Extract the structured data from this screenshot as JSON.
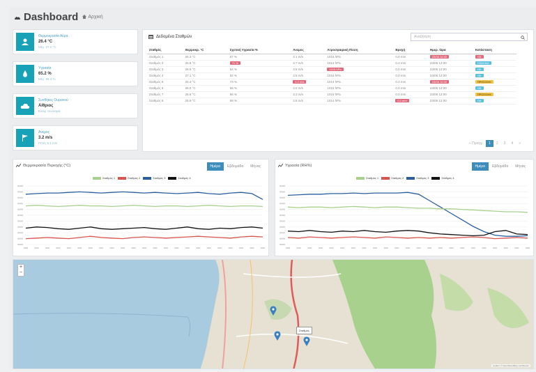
{
  "header": {
    "title": "Dashboard",
    "crumb": "Αρχική"
  },
  "stats": [
    {
      "label": "Θερμοκρασία Αέρα",
      "value": "26.4 °C",
      "sub": "Μέγ. 27.2 °C"
    },
    {
      "label": "Υγρασία",
      "value": "65.2 %",
      "sub": "Μέγ. 66.4 %"
    },
    {
      "label": "Συνθήκες Ουρανού",
      "value": "Αίθριος",
      "sub": "Ελαφ. συννεφιά"
    },
    {
      "label": "Ανεμος",
      "value": "3.2 m/s",
      "sub": "Ριπές 5.1 m/s"
    }
  ],
  "table": {
    "title": "Δεδομένα Σταθμών",
    "search_placeholder": "Αναζήτηση",
    "columns": [
      "Σταθμός",
      "Θερμοκρ. °C",
      "Σχετική Υγρασία %",
      "Ανεμος",
      "Ατμοσφαιρική Πίεση",
      "Βροχή",
      "Ημερ. Ώρα",
      "Κατάσταση"
    ],
    "rows": [
      [
        "Σταθμός 1",
        "26.3 °C",
        "67 %",
        "3.1 m/s",
        "1015 hPa",
        "0.0 mm",
        "23/06 12:00",
        "OK"
      ],
      [
        "Σταθμός 2",
        "25.8 °C",
        "71 %",
        "2.7 m/s",
        "1014 hPa",
        "0.2 mm",
        "23/06 12:00",
        "ΣΦΑΛΜΑ"
      ],
      [
        "Σταθμός 3",
        "26.9 °C",
        "64 %",
        "3.5 m/s",
        "1015 hPa",
        "0.0 mm",
        "23/06 12:00",
        "OK"
      ],
      [
        "Σταθμός 4",
        "27.1 °C",
        "62 %",
        "3.9 m/s",
        "1016 hPa",
        "0.0 mm",
        "23/06 12:00",
        "OK"
      ],
      [
        "Σταθμός 5",
        "25.4 °C",
        "73 %",
        "2.2 m/s",
        "1014 hPa",
        "0.4 mm",
        "23/06 12:00",
        "ΠΡΟΣΟΧΗ"
      ],
      [
        "Σταθμός 6",
        "26.0 °C",
        "68 %",
        "3.0 m/s",
        "1015 hPa",
        "0.0 mm",
        "23/06 12:00",
        "OK"
      ],
      [
        "Σταθμός 7",
        "26.6 °C",
        "66 %",
        "3.3 m/s",
        "1015 hPa",
        "0.0 mm",
        "23/06 12:00",
        "ΠΡΟΣΟΧΗ"
      ],
      [
        "Σταθμός 8",
        "25.9 °C",
        "69 %",
        "2.8 m/s",
        "1014 hPa",
        "0.1 mm",
        "23/06 12:00",
        "OK"
      ]
    ],
    "badges": [
      [
        null,
        null,
        null,
        null,
        null,
        null,
        "red",
        "red"
      ],
      [
        null,
        null,
        "red",
        null,
        null,
        null,
        null,
        "blue"
      ],
      [
        null,
        null,
        null,
        null,
        "red",
        null,
        null,
        "blue"
      ],
      [
        null,
        null,
        null,
        null,
        null,
        null,
        null,
        "blue"
      ],
      [
        null,
        null,
        null,
        "red",
        null,
        null,
        "red",
        "yellow"
      ],
      [
        null,
        null,
        null,
        null,
        null,
        null,
        null,
        "blue"
      ],
      [
        null,
        null,
        null,
        null,
        null,
        null,
        null,
        "yellow"
      ],
      [
        null,
        null,
        null,
        null,
        null,
        "red",
        null,
        "blue"
      ]
    ],
    "pager": {
      "prev": "« Προηγ.",
      "pages": [
        "1",
        "2",
        "3",
        "4",
        "»"
      ]
    }
  },
  "charts": [
    {
      "title": "Θερμοκρασία Περιοχής (°C)",
      "buttons": [
        "Ημέρα",
        "Εβδομάδα",
        "Μήνας"
      ],
      "legend": [
        {
          "name": "Σταθμός 1",
          "color": "#a8d08d"
        },
        {
          "name": "Σταθμός 2",
          "color": "#d9534f"
        },
        {
          "name": "Σταθμός 3",
          "color": "#2a5f9e"
        },
        {
          "name": "Σταθμός 4",
          "color": "#111111"
        }
      ]
    },
    {
      "title": "Υγρασία (RH%)",
      "buttons": [
        "Ημέρα",
        "Εβδομάδα",
        "Μήνας"
      ],
      "legend": [
        {
          "name": "Σταθμός 1",
          "color": "#a8d08d"
        },
        {
          "name": "Σταθμός 2",
          "color": "#d9534f"
        },
        {
          "name": "Σταθμός 3",
          "color": "#2a5f9e"
        },
        {
          "name": "Σταθμός 4",
          "color": "#111111"
        }
      ]
    }
  ],
  "chart_data": [
    {
      "type": "line",
      "title": "Θερμοκρασία Περιοχής (°C)",
      "ylim": [
        0,
        100
      ],
      "series": [
        {
          "name": "Σταθμός 3",
          "color": "#2a5f9e",
          "values": [
            86,
            87,
            88,
            88,
            89,
            90,
            89,
            88,
            89,
            90,
            89,
            88,
            89,
            88,
            87,
            88,
            89,
            87,
            86,
            88,
            89,
            87,
            77
          ]
        },
        {
          "name": "Σταθμός 1",
          "color": "#a8d08d",
          "values": [
            66,
            67,
            66,
            65,
            66,
            67,
            66,
            66,
            65,
            66,
            67,
            66,
            65,
            66,
            66,
            65,
            66,
            67,
            66,
            65,
            66,
            66,
            65
          ]
        },
        {
          "name": "Σταθμός 4",
          "color": "#111111",
          "values": [
            28,
            30,
            29,
            27,
            26,
            28,
            30,
            27,
            26,
            27,
            28,
            29,
            27,
            26,
            28,
            30,
            27,
            26,
            28,
            27,
            29,
            30,
            28
          ]
        },
        {
          "name": "Σταθμός 2",
          "color": "#d9534f",
          "values": [
            10,
            11,
            12,
            11,
            10,
            12,
            14,
            12,
            11,
            10,
            12,
            13,
            12,
            11,
            12,
            13,
            14,
            13,
            12,
            11,
            13,
            14,
            13
          ]
        }
      ]
    },
    {
      "type": "line",
      "title": "Υγρασία (RH%)",
      "ylim": [
        0,
        100
      ],
      "series": [
        {
          "name": "Σταθμός 3",
          "color": "#2a5f9e",
          "values": [
            84,
            85,
            86,
            86,
            87,
            87,
            88,
            87,
            88,
            88,
            88,
            89,
            86,
            75,
            64,
            53,
            42,
            31,
            22,
            16,
            14,
            14,
            15
          ]
        },
        {
          "name": "Σταθμός 1",
          "color": "#a8d08d",
          "values": [
            64,
            63,
            64,
            64,
            63,
            64,
            65,
            64,
            63,
            64,
            64,
            63,
            62,
            62,
            61,
            61,
            60,
            59,
            58,
            57,
            56,
            56,
            55
          ]
        },
        {
          "name": "Σταθμός 4",
          "color": "#111111",
          "values": [
            23,
            22,
            24,
            22,
            21,
            23,
            22,
            24,
            22,
            21,
            23,
            24,
            23,
            20,
            18,
            17,
            16,
            15,
            16,
            22,
            24,
            18,
            17
          ]
        },
        {
          "name": "Σταθμός 2",
          "color": "#d9534f",
          "values": [
            12,
            11,
            13,
            12,
            11,
            12,
            13,
            12,
            11,
            13,
            12,
            11,
            12,
            11,
            12,
            11,
            12,
            13,
            12,
            10,
            11,
            12,
            11
          ]
        }
      ]
    }
  ],
  "map": {
    "zoom_in": "+",
    "zoom_out": "−",
    "marker_label": "Σταθμός",
    "attribution": "Leaflet | © OpenStreetMap contributors"
  },
  "colors": {
    "accent": "#17a2b8",
    "primary_btn": "#3c8dbc"
  }
}
